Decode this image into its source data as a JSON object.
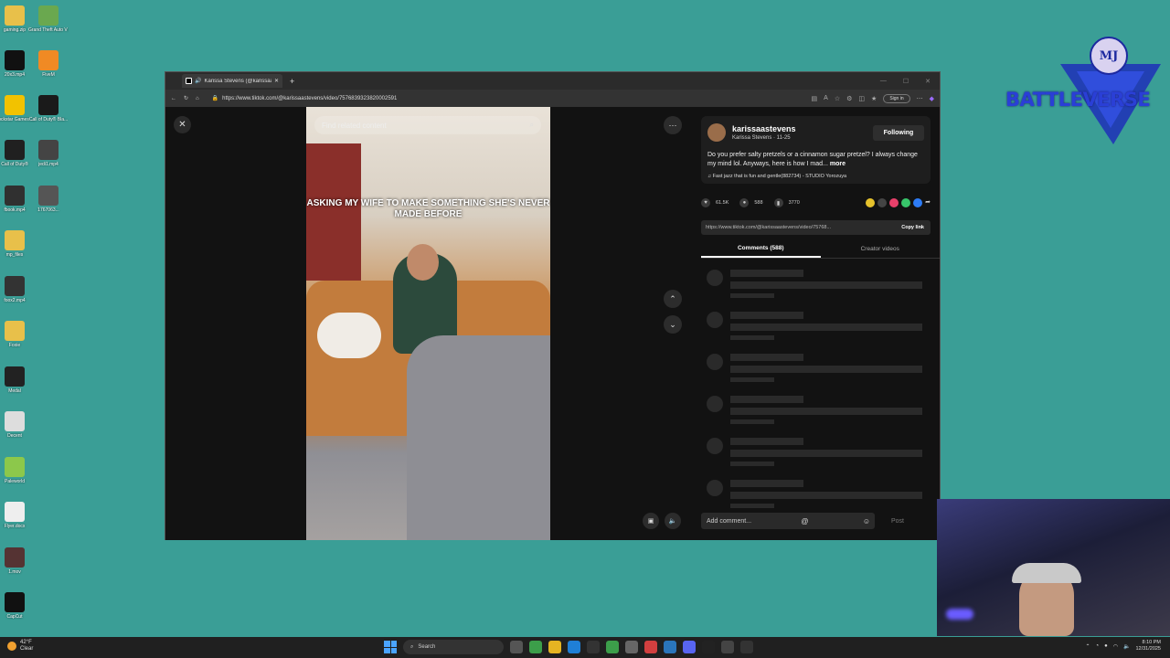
{
  "desktop_icons": [
    {
      "label": "gaming.zip",
      "color": "#e8c04a"
    },
    {
      "label": "Grand Theft Auto V Le...",
      "color": "#6aa84f"
    },
    {
      "label": "20x3.mp4",
      "color": "#111111"
    },
    {
      "label": "FiveM",
      "color": "#f08a24"
    },
    {
      "label": "Rockstar Games ...",
      "color": "#f2c200"
    },
    {
      "label": "Call of Duty® Bla...",
      "color": "#1a1a1a"
    },
    {
      "label": "Call of Duty®",
      "color": "#202020"
    },
    {
      "label": "jedi1.mp4",
      "color": "#444444"
    },
    {
      "label": "fbook.mp4",
      "color": "#303030"
    },
    {
      "label": "1767063...",
      "color": "#555555"
    },
    {
      "label": "mp_files",
      "color": "#e8c04a"
    },
    {
      "label": "foox2.mp4",
      "color": "#333333"
    },
    {
      "label": "Foxie",
      "color": "#e8c04a"
    },
    {
      "label": "Medal",
      "color": "#222222"
    },
    {
      "label": "Decent",
      "color": "#dddddd"
    },
    {
      "label": "Paleworld",
      "color": "#8cc84b"
    },
    {
      "label": "Flyer.docx",
      "color": "#eeeeee"
    },
    {
      "label": "1.mov",
      "color": "#553333"
    },
    {
      "label": "CapCut",
      "color": "#111111"
    }
  ],
  "browser": {
    "tab_title": "Karissa Stevens (@karissaastevens)",
    "new_tab": "+",
    "url": "https://www.tiktok.com/@karissaastevens/video/7576839323820002591",
    "sign_in": "Sign in"
  },
  "video": {
    "search_placeholder": "Find related content",
    "caption": "ASKING MY WIFE TO MAKE SOMETHING SHE'S NEVER MADE BEFORE"
  },
  "post": {
    "username": "karissaastevens",
    "subline": "Karissa Stevens · 11-25",
    "follow_label": "Following",
    "description": "Do you prefer salty pretzels or a cinnamon sugar pretzel? I always change my mind lol. Anyways, here is how I mad...",
    "more": "more",
    "music": "♫  Fast jazz that is fun and gentle(882734) - STUDIO Yorozuya",
    "likes": "61.5K",
    "comments": "588",
    "saves": "3770",
    "share_link": "https://www.tiktok.com/@karissaastevens/video/75768...",
    "copy_link": "Copy link"
  },
  "tabs": {
    "comments": "Comments (588)",
    "creator_videos": "Creator videos"
  },
  "comment_box": {
    "placeholder": "Add comment...",
    "post": "Post"
  },
  "logo": {
    "text": "BATTLEVERSE",
    "monogram": "MJ"
  },
  "taskbar": {
    "weather_temp": "42°F",
    "weather_desc": "Clear",
    "search": "Search",
    "time": "8:10 PM",
    "date": "12/31/2025"
  }
}
